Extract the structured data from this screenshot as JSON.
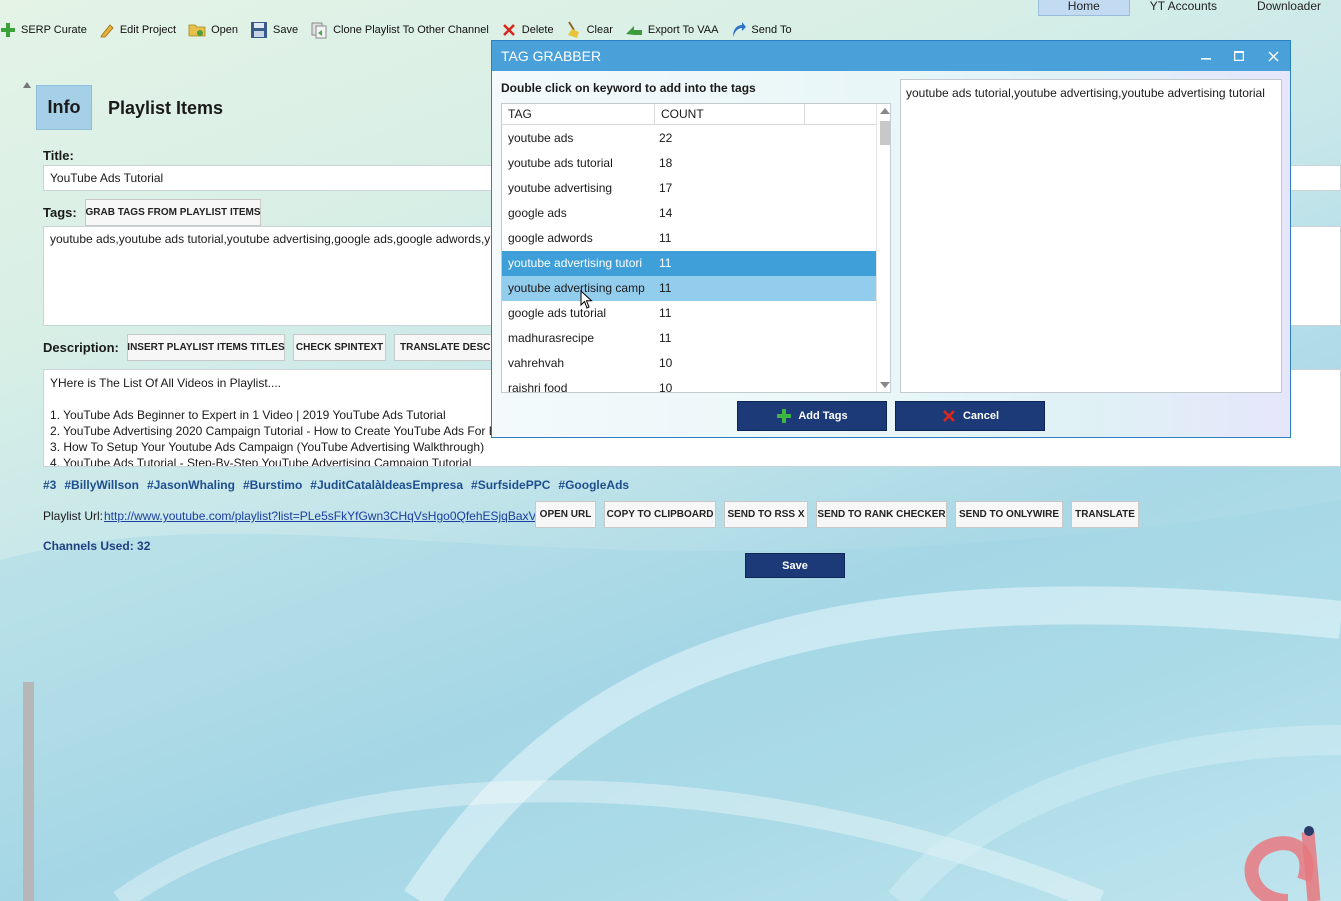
{
  "toolbar": {
    "buttons": [
      {
        "label": "SERP Curate",
        "icon": "plus-icon"
      },
      {
        "label": "Edit Project",
        "icon": "pencil-icon"
      },
      {
        "label": "Open",
        "icon": "folder-icon"
      },
      {
        "label": "Save",
        "icon": "floppy-icon"
      },
      {
        "label": "Clone Playlist To Other Channel",
        "icon": "clone-icon"
      },
      {
        "label": "Delete",
        "icon": "x-icon"
      },
      {
        "label": "Clear",
        "icon": "broom-icon"
      },
      {
        "label": "Export To VAA",
        "icon": "export-icon"
      },
      {
        "label": "Send To",
        "icon": "send-icon"
      }
    ]
  },
  "nav": {
    "tabs": [
      "Home",
      "YT Accounts",
      "Downloader"
    ],
    "active": "Home"
  },
  "main": {
    "tabs": [
      "Info",
      "Playlist Items"
    ],
    "title_label": "Title:",
    "title_value": "YouTube Ads Tutorial",
    "tags_label": "Tags:",
    "grab_tags_button": "GRAB TAGS FROM PLAYLIST ITEMS",
    "tags_value": "youtube ads,youtube ads tutorial,youtube advertising,google ads,google adwords,y",
    "description_label": "Description:",
    "desc_buttons": [
      "INSERT PLAYLIST ITEMS TITLES",
      "CHECK SPINTEXT",
      "TRANSLATE DESCR"
    ],
    "description_lines": [
      "YHere is The List Of  All Videos in Playlist....",
      "",
      "1. YouTube Ads Beginner to Expert in 1 Video | 2019 YouTube Ads Tutorial",
      "2. YouTube Advertising 2020 Campaign Tutorial - How to Create YouTube Ads For B",
      "3. How To Setup Your Youtube Ads Campaign (YouTube Advertising Walkthrough)",
      "4. YouTube Ads Tutorial - Step-By-Step YouTube Advertising Campaign Tutorial"
    ],
    "hashtags": [
      "#3",
      "#BillyWillson",
      "#JasonWhaling",
      "#Burstimo",
      "#JuditCatalàIdeasEmpresa",
      "#SurfsidePPC",
      "#GoogleAds"
    ],
    "playlist_url_label": "Playlist Url:",
    "playlist_url": "http://www.youtube.com/playlist?list=PLe5sFkYfGwn3CHqVsHgo0QfehESjqBaxV",
    "url_buttons": [
      "OPEN URL",
      "COPY TO CLIPBOARD",
      "SEND TO RSS X",
      "SEND TO RANK CHECKER",
      "SEND TO ONLYWIRE",
      "TRANSLATE"
    ],
    "channels_used": "Channels Used: 32",
    "save_button": "Save"
  },
  "dialog": {
    "title": "TAG GRABBER",
    "caption": "Double click on keyword to add into the tags",
    "columns": [
      "TAG",
      "COUNT"
    ],
    "rows": [
      {
        "tag": "youtube ads",
        "count": "22"
      },
      {
        "tag": "youtube ads tutorial",
        "count": "18"
      },
      {
        "tag": "youtube advertising",
        "count": "17"
      },
      {
        "tag": "google ads",
        "count": "14"
      },
      {
        "tag": "google adwords",
        "count": "11"
      },
      {
        "tag": "youtube advertising tutori",
        "count": "11"
      },
      {
        "tag": "youtube advertising camp",
        "count": "11"
      },
      {
        "tag": "google ads tutorial",
        "count": "11"
      },
      {
        "tag": "madhurasrecipe",
        "count": "11"
      },
      {
        "tag": "vahrehvah",
        "count": "10"
      },
      {
        "tag": "rajshri food",
        "count": "10"
      }
    ],
    "selected_row": 5,
    "hover_row": 6,
    "selected_tags": "youtube ads tutorial,youtube advertising,youtube advertising tutorial",
    "add_button": "Add Tags",
    "cancel_button": "Cancel"
  },
  "colors": {
    "dialog_title_bar": "#4aa0d8",
    "selected_row": "#3f9fd8",
    "hover_row": "#93cdee",
    "primary_button": "#1d3a78",
    "hashtag": "#1f4f8f"
  }
}
